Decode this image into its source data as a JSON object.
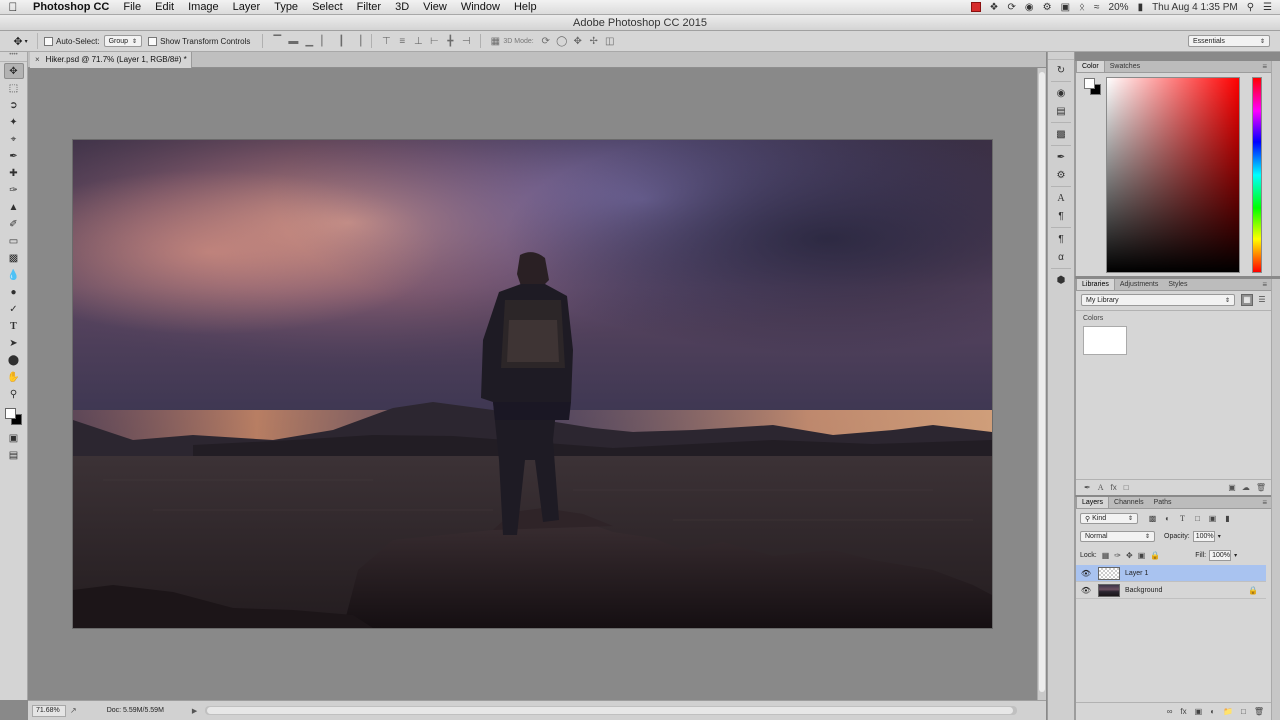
{
  "menubar": {
    "apple_icon": "apple-logo-icon",
    "app_name": "Photoshop CC",
    "items": [
      "File",
      "Edit",
      "Image",
      "Layer",
      "Type",
      "Select",
      "Filter",
      "3D",
      "View",
      "Window",
      "Help"
    ],
    "battery": "20%",
    "datetime": "Thu Aug 4  1:35 PM"
  },
  "window": {
    "title": "Adobe Photoshop CC 2015"
  },
  "options": {
    "auto_select_label": "Auto-Select:",
    "auto_select_value": "Group",
    "transform_label": "Show Transform Controls",
    "mode_3d_label": "3D Mode:",
    "workspace": "Essentials"
  },
  "document": {
    "tab_label": "Hiker.psd @ 71.7% (Layer 1, RGB/8#) *",
    "zoom": "71.68%",
    "doc_size": "Doc: 5.59M/5.59M"
  },
  "tools": [
    "move-tool",
    "marquee-tool",
    "lasso-tool",
    "quick-select-tool",
    "crop-tool",
    "eyedropper-tool",
    "healing-tool",
    "brush-tool",
    "clone-stamp-tool",
    "history-brush-tool",
    "eraser-tool",
    "gradient-tool",
    "blur-tool",
    "dodge-tool",
    "pen-tool",
    "type-tool",
    "path-select-tool",
    "shape-tool",
    "hand-tool",
    "zoom-tool"
  ],
  "color_panel": {
    "tabs": [
      "Color",
      "Swatches"
    ],
    "foreground": "#ffffff",
    "background": "#000000"
  },
  "libraries_panel": {
    "tabs": [
      "Libraries",
      "Adjustments",
      "Styles"
    ],
    "library": "My Library",
    "colors_label": "Colors",
    "swatch_color": "#ffffff"
  },
  "layers_panel": {
    "tabs": [
      "Layers",
      "Channels",
      "Paths"
    ],
    "filter_kind": "Kind",
    "blend_mode": "Normal",
    "opacity_label": "Opacity:",
    "opacity": "100%",
    "lock_label": "Lock:",
    "fill_label": "Fill:",
    "fill": "100%",
    "layers": [
      {
        "name": "Layer 1",
        "selected": true,
        "locked": false
      },
      {
        "name": "Background",
        "selected": false,
        "locked": true
      }
    ]
  }
}
